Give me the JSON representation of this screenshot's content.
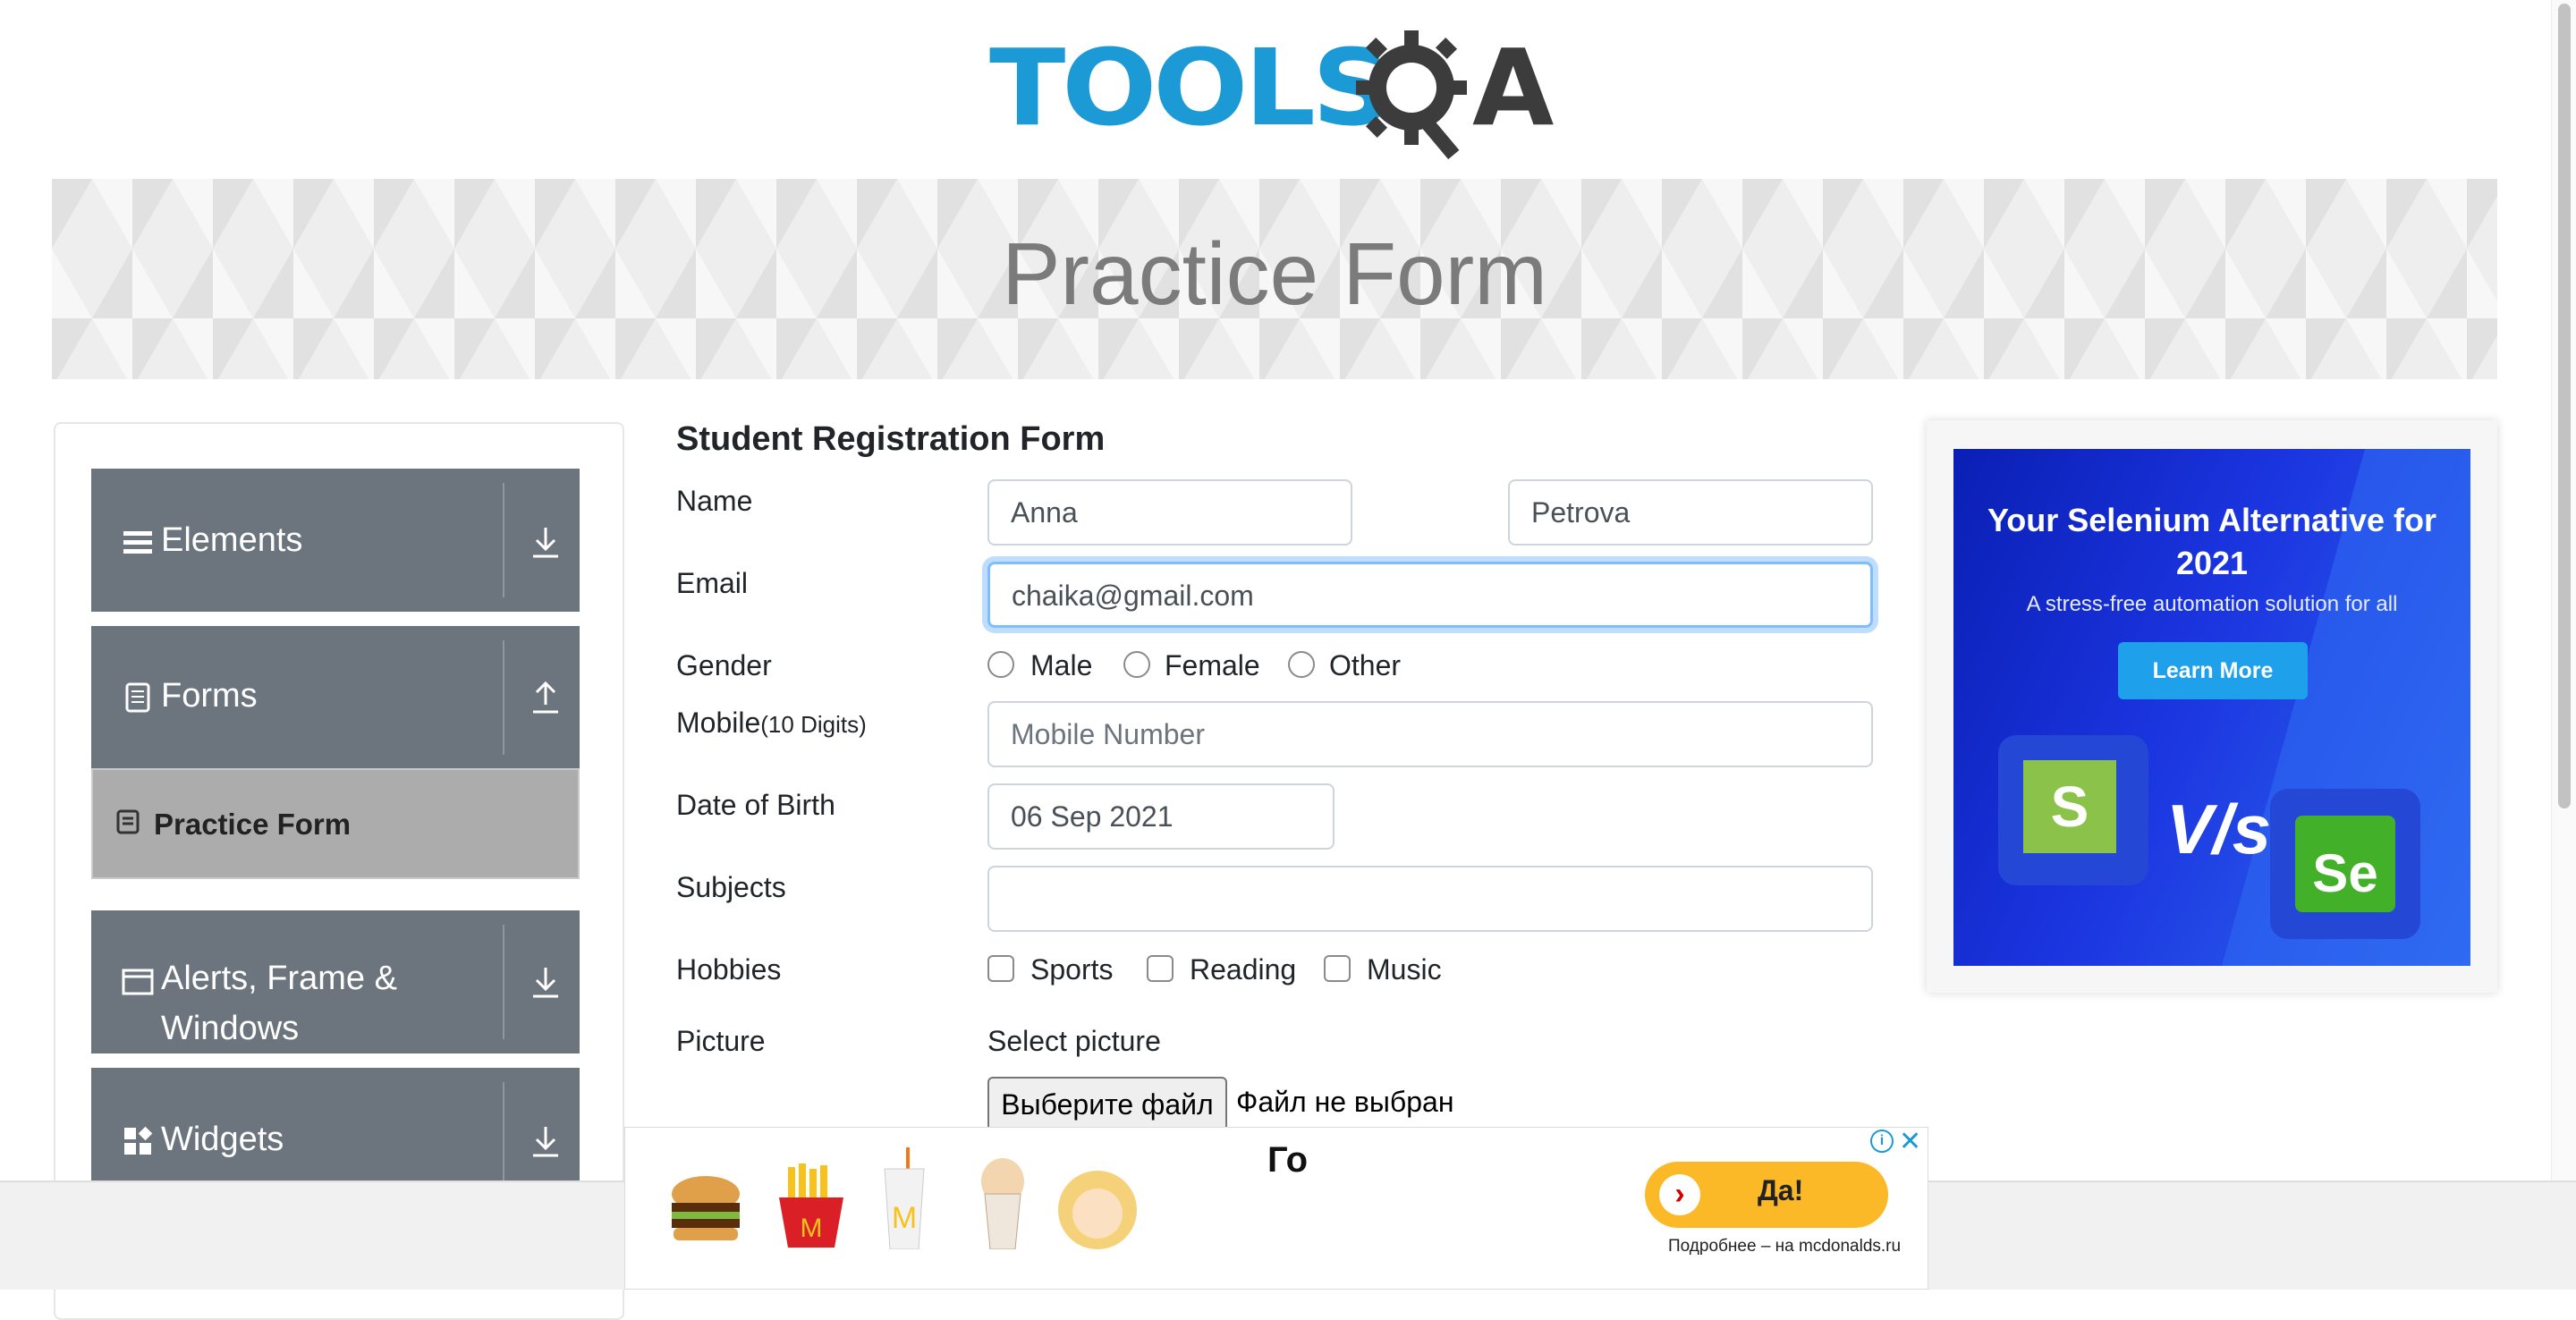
{
  "header": {
    "logo_text": "TOOLSQA",
    "logo_tools": "TOOLS",
    "logo_a": "A",
    "banner_title": "Practice Form"
  },
  "sidebar": {
    "groups": [
      {
        "label": "Elements",
        "icon": "hamburger-icon",
        "arrow": "download-arrow-icon"
      },
      {
        "label": "Forms",
        "icon": "document-icon",
        "arrow": "upload-arrow-icon"
      },
      {
        "label_line1": "Alerts, Frame &",
        "label_line2": "Windows",
        "icon": "window-icon",
        "arrow": "download-arrow-icon"
      },
      {
        "label": "Widgets",
        "icon": "widgets-icon",
        "arrow": "download-arrow-icon"
      }
    ],
    "active_item": "Practice Form"
  },
  "form": {
    "title": "Student Registration Form",
    "name_label": "Name",
    "first_name": "Anna",
    "last_name": "Petrova",
    "email_label": "Email",
    "email": "chaika@gmail.com",
    "gender_label": "Gender",
    "gender_options": [
      "Male",
      "Female",
      "Other"
    ],
    "mobile_label": "Mobile",
    "mobile_hint": "(10 Digits)",
    "mobile_placeholder": "Mobile Number",
    "dob_label": "Date of Birth",
    "dob": "06 Sep 2021",
    "subjects_label": "Subjects",
    "subjects": "",
    "hobbies_label": "Hobbies",
    "hobbies": [
      "Sports",
      "Reading",
      "Music"
    ],
    "picture_label": "Picture",
    "select_picture": "Select picture",
    "file_button": "Выберите файл",
    "file_status": "Файл не выбран"
  },
  "ad_right": {
    "headline": "Your Selenium Alternative for 2021",
    "subtitle": "A stress-free automation solution for all",
    "button": "Learn More",
    "vs": "V/s",
    "logo_left": "S",
    "logo_right": "Se"
  },
  "ad_bottom": {
    "headline": "Го",
    "cta": "Да!",
    "more": "Подробнее – на mcdonalds.ru",
    "info": "i",
    "close": "✕",
    "arrow": "›"
  },
  "colors": {
    "brand_blue": "#1c9ad6",
    "sidebar_gray": "#6c757d",
    "focus_border": "#80bdff",
    "ad_blue": "#1b35e0",
    "cta_yellow": "#fbb928"
  }
}
